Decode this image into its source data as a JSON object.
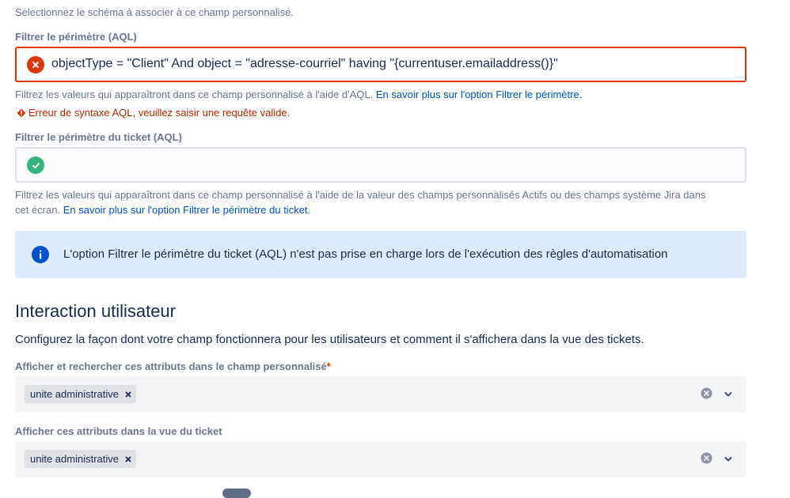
{
  "intro_text": "Sélectionnez le schéma à associer à ce champ personnalisé.",
  "aql_filter": {
    "label": "Filtrer le périmètre (AQL)",
    "value": "objectType = \"Client\" And object = \"adresse-courriel\" having \"{currentuser.emailaddress()}\"",
    "help_text": "Filtrez les valeurs qui apparaîtront dans ce champ personnalisé à l'aide d'AQL. ",
    "help_link": "En savoir plus sur l'option Filtrer le périmètre.",
    "error_text": "Erreur de syntaxe AQL, veuillez saisir une requête valide."
  },
  "ticket_filter": {
    "label": "Filtrer le périmètre du ticket (AQL)",
    "value": "",
    "help_text_line1": "Filtrez les valeurs qui apparaîtront dans ce champ personnalisé à l'aide de la valeur des champs personnalisés Actifs ou des champs système Jira dans",
    "help_text_line2": "cet écran. ",
    "help_link": "En savoir plus sur l'option Filtrer le périmètre du ticket."
  },
  "info_panel": {
    "text": "L'option Filtrer le périmètre du ticket (AQL) n'est pas prise en charge lors de l'exécution des règles d'automatisation"
  },
  "interaction": {
    "heading": "Interaction utilisateur",
    "description": "Configurez la façon dont votre champ fonctionnera pour les utilisateurs et comment il s'affichera dans la vue des tickets.",
    "search_field": {
      "label": "Afficher et rechercher ces attributs dans le champ personnalisé",
      "required_marker": "*",
      "tag": "unite administrative"
    },
    "view_field": {
      "label": "Afficher ces attributs dans la vue du ticket",
      "tag": "unite administrative"
    }
  },
  "colors": {
    "error": "#de350b",
    "success": "#36b37e",
    "info": "#0052cc",
    "link": "#0052cc"
  },
  "icons": {
    "error": "error-x-icon",
    "success": "checkmark-icon",
    "info": "info-icon",
    "warning": "warning-diamond-icon",
    "clear": "clear-icon",
    "chevron": "chevron-down-icon"
  }
}
